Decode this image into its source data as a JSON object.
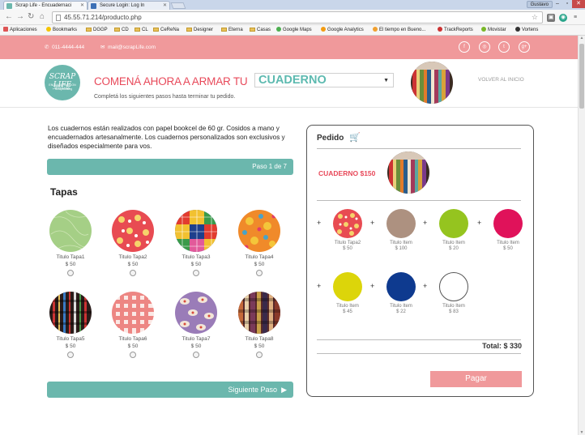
{
  "browser": {
    "tabs": [
      {
        "title": "Scrap Life - Encuadernaci",
        "active": true
      },
      {
        "title": "Secure Login: Log In",
        "active": false
      }
    ],
    "user": "Gustavo",
    "url": "45.55.71.214/producto.php",
    "bookmarks": [
      "Aplicaciones",
      "Bookmarks",
      "DGGP",
      "CD",
      "CL",
      "CeReNa",
      "Designer",
      "Eterna",
      "Casas",
      "Google Maps",
      "Google Analytics",
      "El tiempo en Bueno...",
      "TrackReports",
      "Movistar",
      "Vortens"
    ]
  },
  "topbar": {
    "phone": "011-4444-444",
    "email": "mail@scrapLife.com",
    "social": [
      "f",
      "◎",
      "t",
      "g+"
    ]
  },
  "header": {
    "logo_line1": "SCRAP LIFE",
    "logo_line2": "ENCUADERNACION ARTESANAL",
    "logo_line3": "+ Scrapbooking",
    "headline": "COMENÁ AHORA A ARMAR TU",
    "product_select": "CUADERNO",
    "subtext": "Completá los siguientes pasos hasta terminar tu pedido.",
    "back_link": "VOLVER AL INICIO"
  },
  "intro": "Los cuadernos están realizados con papel bookcel de 60 gr. Cosidos a mano y encuadernados artesanalmente. Los cuadernos personalizados son exclusivos y diseñados especialmente para vos.",
  "step": "Paso 1 de 7",
  "section_title": "Tapas",
  "tapas": [
    {
      "title": "Titulo Tapa1",
      "price": "$ 50"
    },
    {
      "title": "Titulo Tapa2",
      "price": "$ 50"
    },
    {
      "title": "Titulo Tapa3",
      "price": "$ 50"
    },
    {
      "title": "Titulo Tapa4",
      "price": "$ 50"
    },
    {
      "title": "Titulo Tapa5",
      "price": "$ 50"
    },
    {
      "title": "Titulo Tapa6",
      "price": "$ 50"
    },
    {
      "title": "Titulo Tapa7",
      "price": "$ 50"
    },
    {
      "title": "Titulo Tapa8",
      "price": "$ 50"
    }
  ],
  "next_step": "Siguiente Paso",
  "order": {
    "title": "Pedido",
    "product": "CUADERNO $150",
    "items": [
      {
        "title": "Titulo Tapa2",
        "price": "$ 50",
        "color": "#e84b52"
      },
      {
        "title": "Titulo Item",
        "price": "$ 100",
        "color": "#ad9180"
      },
      {
        "title": "Titulo Item",
        "price": "$ 20",
        "color": "#95c41f"
      },
      {
        "title": "Titulo Item",
        "price": "$ 50",
        "color": "#e0125a"
      },
      {
        "title": "Titulo Item",
        "price": "$ 45",
        "color": "#dcd50a"
      },
      {
        "title": "Titulo Item",
        "price": "$ 22",
        "color": "#0e3a8f"
      },
      {
        "title": "Titulo Item",
        "price": "$ 83",
        "color": "#ffffff"
      }
    ],
    "plus_sign": "+",
    "total": "Total: $ 330",
    "pay_button": "Pagar"
  }
}
